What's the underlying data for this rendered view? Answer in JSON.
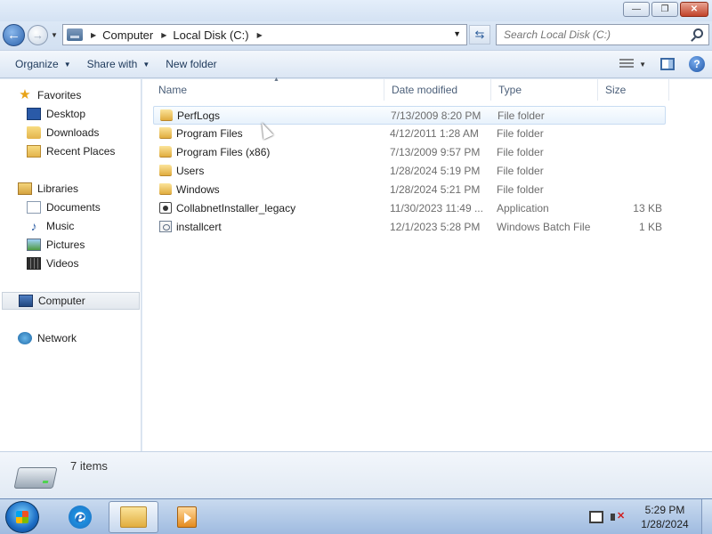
{
  "window": {
    "minimize_label": "—",
    "maximize_label": "❐",
    "close_label": "✕"
  },
  "address": {
    "crumbs": [
      "Computer",
      "Local Disk (C:)"
    ],
    "search_placeholder": "Search Local Disk (C:)"
  },
  "toolbar": {
    "organize": "Organize",
    "share_with": "Share with",
    "new_folder": "New folder",
    "help": "?"
  },
  "nav": {
    "favorites": "Favorites",
    "desktop": "Desktop",
    "downloads": "Downloads",
    "recent_places": "Recent Places",
    "libraries": "Libraries",
    "documents": "Documents",
    "music": "Music",
    "pictures": "Pictures",
    "videos": "Videos",
    "computer": "Computer",
    "network": "Network"
  },
  "columns": {
    "name": "Name",
    "date_modified": "Date modified",
    "type": "Type",
    "size": "Size"
  },
  "files": [
    {
      "name": "PerfLogs",
      "date": "7/13/2009 8:20 PM",
      "type": "File folder",
      "size": "",
      "icon": "folder-icon"
    },
    {
      "name": "Program Files",
      "date": "4/12/2011 1:28 AM",
      "type": "File folder",
      "size": "",
      "icon": "folder-icon"
    },
    {
      "name": "Program Files (x86)",
      "date": "7/13/2009 9:57 PM",
      "type": "File folder",
      "size": "",
      "icon": "folder-icon"
    },
    {
      "name": "Users",
      "date": "1/28/2024 5:19 PM",
      "type": "File folder",
      "size": "",
      "icon": "folder-icon"
    },
    {
      "name": "Windows",
      "date": "1/28/2024 5:21 PM",
      "type": "File folder",
      "size": "",
      "icon": "folder-icon"
    },
    {
      "name": "CollabnetInstaller_legacy",
      "date": "11/30/2023 11:49 ...",
      "type": "Application",
      "size": "13 KB",
      "icon": "application-icon"
    },
    {
      "name": "installcert",
      "date": "12/1/2023 5:28 PM",
      "type": "Windows Batch File",
      "size": "1 KB",
      "icon": "batch-file-icon"
    }
  ],
  "details": {
    "item_count": "7 items"
  },
  "taskbar": {
    "time": "5:29 PM",
    "date": "1/28/2024"
  }
}
